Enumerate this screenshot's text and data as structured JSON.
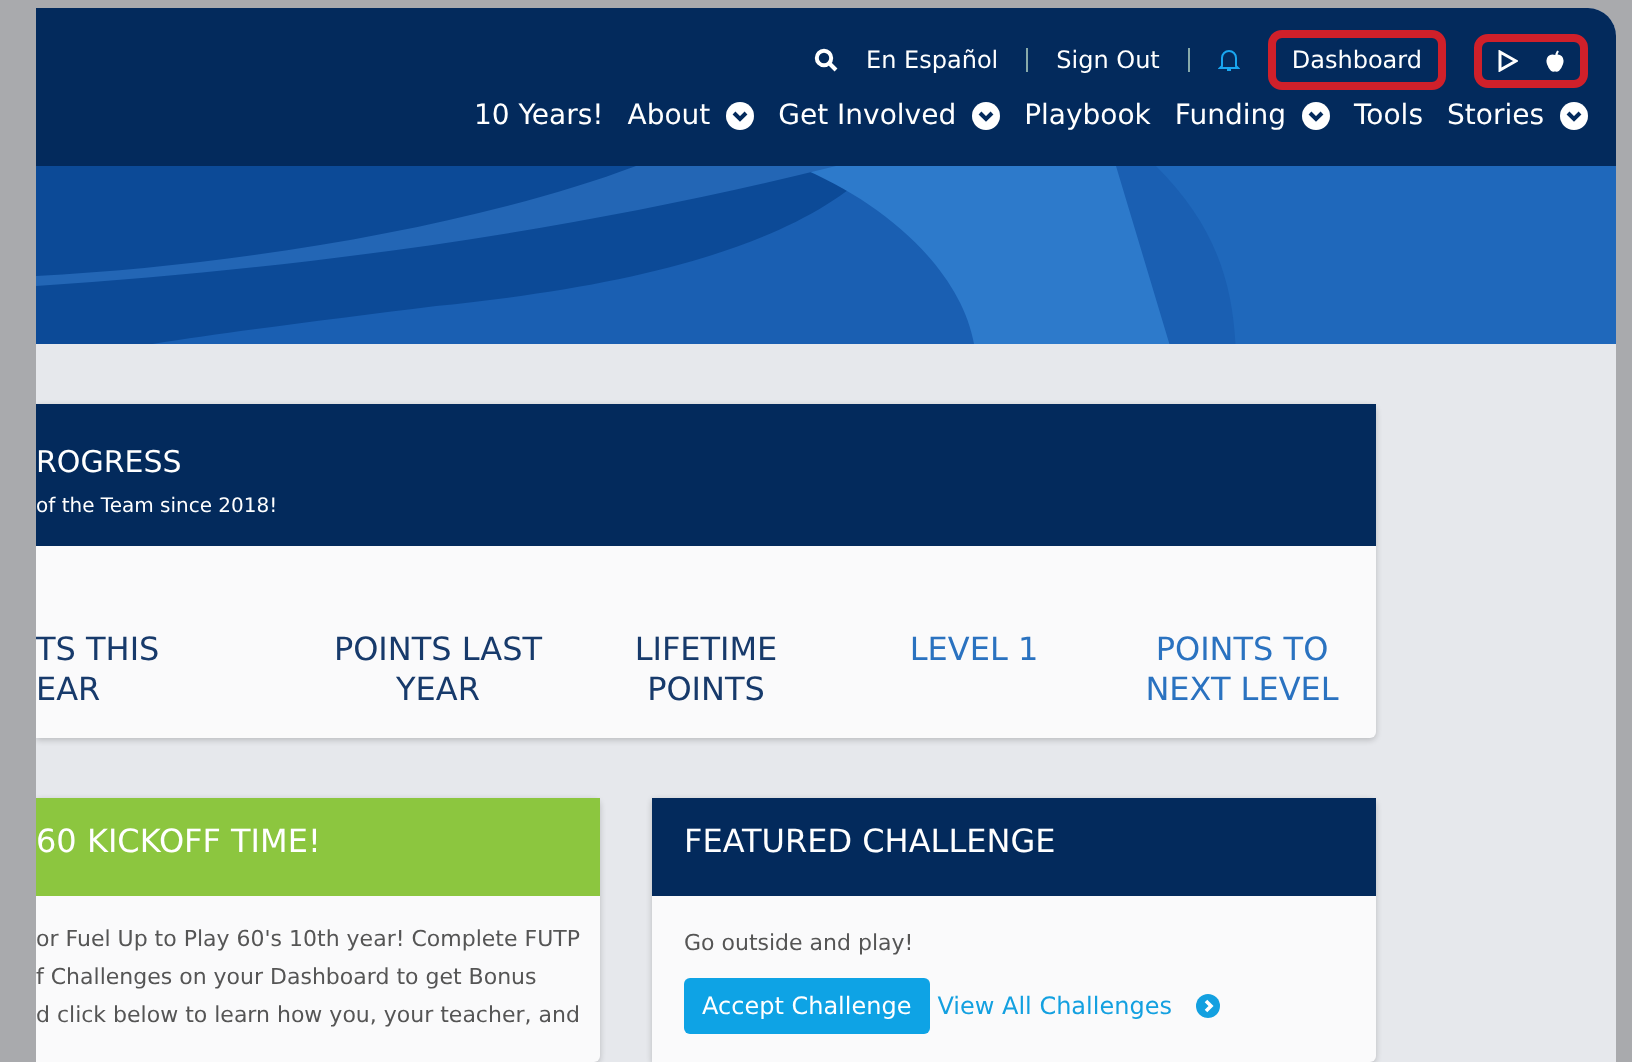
{
  "top_links": [
    {
      "kind": "search"
    },
    {
      "kind": "link",
      "label": "En Español"
    },
    {
      "kind": "link",
      "label": "Sign Out"
    },
    {
      "kind": "bell"
    },
    {
      "kind": "button",
      "label": "Dashboard",
      "highlighted": true
    },
    {
      "kind": "apps",
      "highlighted": true
    }
  ],
  "nav": [
    {
      "label": "10 Years!",
      "dropdown": false
    },
    {
      "label": "About",
      "dropdown": true
    },
    {
      "label": "Get Involved",
      "dropdown": true
    },
    {
      "label": "Playbook",
      "dropdown": false
    },
    {
      "label": "Funding",
      "dropdown": true
    },
    {
      "label": "Tools",
      "dropdown": false
    },
    {
      "label": "Stories",
      "dropdown": true
    }
  ],
  "progress": {
    "title": "ROGRESS",
    "subtitle": "of the Team since 2018!",
    "stats": [
      {
        "label": "TS THIS\nEAR",
        "kind": "points"
      },
      {
        "label": "POINTS LAST\nYEAR",
        "kind": "points"
      },
      {
        "label": "LIFETIME\nPOINTS",
        "kind": "points"
      },
      {
        "label": "LEVEL 1",
        "kind": "level"
      },
      {
        "label": "POINTS TO\nNEXT LEVEL",
        "kind": "level"
      }
    ]
  },
  "kickoff": {
    "title": "60 KICKOFF TIME!",
    "text": "or Fuel Up to Play 60's 10th year! Complete FUTP\nf Challenges on your Dashboard to get Bonus\nd click below to learn how you, your teacher, and"
  },
  "featured": {
    "title": "FEATURED CHALLENGE",
    "text": "Go outside and play!",
    "button": "Accept Challenge",
    "link": "View All Challenges"
  }
}
